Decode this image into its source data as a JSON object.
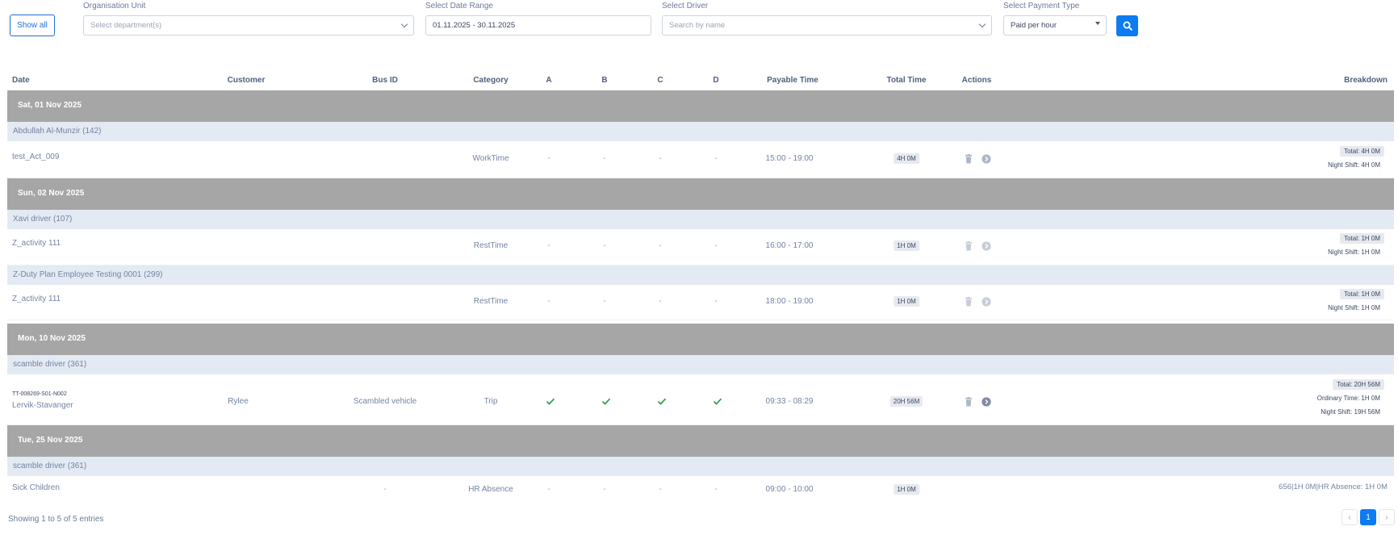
{
  "filters": {
    "show_all": "Show all",
    "org_unit": {
      "label": "Organisation Unit",
      "placeholder": "Select department(s)"
    },
    "date_range": {
      "label": "Select Date Range",
      "value": "01.11.2025 - 30.11.2025"
    },
    "driver": {
      "label": "Select Driver",
      "placeholder": "Search by name"
    },
    "payment_type": {
      "label": "Select Payment Type",
      "value": "Paid per hour"
    }
  },
  "table": {
    "headers": {
      "date": "Date",
      "customer": "Customer",
      "bus_id": "Bus ID",
      "category": "Category",
      "a": "A",
      "b": "B",
      "c": "C",
      "d": "D",
      "payable_time": "Payable Time",
      "total_time": "Total Time",
      "actions": "Actions",
      "breakdown": "Breakdown"
    },
    "groups": [
      {
        "date": "Sat, 01 Nov 2025",
        "drivers": [
          {
            "name": "Abdullah Al-Munzir (142)",
            "entries": [
              {
                "date_cell": "test_Act_009",
                "customer": "",
                "bus_id": "",
                "category": "WorkTime",
                "a": "-",
                "b": "-",
                "c": "-",
                "d": "-",
                "payable_time": "15:00 - 19:00",
                "total_time": "4H 0M",
                "breakdown": [
                  "Total: 4H 0M",
                  "Night Shift: 4H 0M"
                ]
              }
            ]
          }
        ]
      },
      {
        "date": "Sun, 02 Nov 2025",
        "drivers": [
          {
            "name": "Xavi driver (107)",
            "entries": [
              {
                "date_cell": "Z_activity 111",
                "customer": "",
                "bus_id": "",
                "category": "RestTime",
                "a": "-",
                "b": "-",
                "c": "-",
                "d": "-",
                "payable_time": "16:00 - 17:00",
                "total_time": "1H 0M",
                "breakdown": [
                  "Total: 1H 0M",
                  "Night Shift: 1H 0M"
                ]
              }
            ]
          },
          {
            "name": "Z-Duty Plan Employee Testing 0001 (299)",
            "entries": [
              {
                "date_cell": "Z_activity 111",
                "customer": "",
                "bus_id": "",
                "category": "RestTime",
                "a": "-",
                "b": "-",
                "c": "-",
                "d": "-",
                "payable_time": "18:00 - 19:00",
                "total_time": "1H 0M",
                "breakdown": [
                  "Total: 1H 0M",
                  "Night Shift: 1H 0M"
                ]
              }
            ]
          }
        ]
      },
      {
        "date": "Mon, 10 Nov 2025",
        "drivers": [
          {
            "name": "scamble driver (361)",
            "entries": [
              {
                "date_cell_small": "TT-008269-S01-N002",
                "date_cell": "Lervik-Stavanger",
                "customer": "Rylee",
                "bus_id": "Scambled vehicle",
                "category": "Trip",
                "a": "check",
                "b": "check",
                "c": "check",
                "d": "check",
                "payable_time": "09:33 - 08:29",
                "total_time": "20H 56M",
                "breakdown": [
                  "Total: 20H 56M",
                  "Ordinary Time: 1H 0M",
                  "Night Shift: 19H 56M"
                ]
              }
            ]
          }
        ]
      },
      {
        "date": "Tue, 25 Nov 2025",
        "drivers": [
          {
            "name": "scamble driver (361)",
            "entries": [
              {
                "date_cell": "Sick Children",
                "customer": "",
                "bus_id": "-",
                "category": "HR Absence",
                "a": "-",
                "b": "-",
                "c": "-",
                "d": "-",
                "payable_time": "09:00 - 10:00",
                "total_time": "1H 0M",
                "breakdown_text": "656|1H 0M|HR Absence: 1H 0M"
              }
            ]
          }
        ]
      }
    ]
  },
  "footer": {
    "info": "Showing 1 to 5 of 5 entries",
    "prev": "‹",
    "page": "1",
    "next": "›"
  },
  "colors": {
    "accent": "#0d7bf2",
    "date_row": "#a6a6a6",
    "driver_row": "#e4eaf3",
    "check": "#1f9d3a"
  }
}
